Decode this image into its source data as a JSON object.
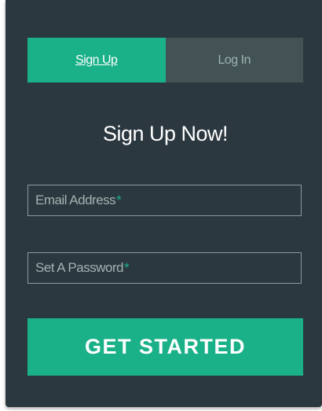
{
  "tabs": [
    {
      "label": "Sign Up",
      "active": true
    },
    {
      "label": "Log In",
      "active": false
    }
  ],
  "title": "Sign Up Now!",
  "fields": {
    "email": {
      "placeholder": "Email Address",
      "required_mark": "*"
    },
    "password": {
      "placeholder": "Set A Password",
      "required_mark": "*"
    }
  },
  "cta_label": "GET STARTED",
  "colors": {
    "background": "#2b3840",
    "accent": "#1ab188",
    "inactive_tab": "#435355",
    "muted_text": "#a0b3b0"
  }
}
